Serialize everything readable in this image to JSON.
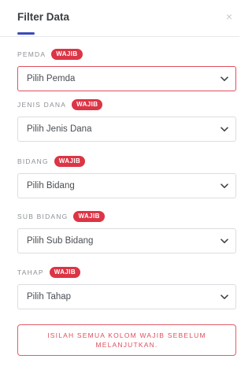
{
  "header": {
    "title": "Filter Data",
    "close_glyph": "×"
  },
  "required_badge": "WAJIB",
  "fields": [
    {
      "label": "PEMDA",
      "placeholder": "Pilih Pemda"
    },
    {
      "label": "JENIS DANA",
      "placeholder": "Pilih Jenis Dana"
    },
    {
      "label": "BIDANG",
      "placeholder": "Pilih Bidang"
    },
    {
      "label": "SUB BIDANG",
      "placeholder": "Pilih Sub Bidang"
    },
    {
      "label": "TAHAP",
      "placeholder": "Pilih Tahap"
    }
  ],
  "alert": {
    "text": "ISILAH SEMUA KOLOM WAJIB SEBELUM MELANJUTKAN."
  },
  "colors": {
    "accent": "#3b4bb8",
    "required": "#dc3545",
    "error_border": "#e04f5c"
  },
  "icons": {
    "close": "close-icon",
    "dropdown": "chevron-down-icon"
  }
}
